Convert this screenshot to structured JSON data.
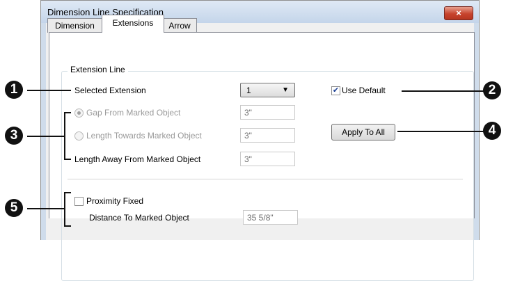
{
  "window": {
    "title": "Dimension Line Specification",
    "close_icon": "×"
  },
  "tabs": [
    {
      "label": "Dimension"
    },
    {
      "label": "Extensions"
    },
    {
      "label": "Arrow"
    }
  ],
  "extension_line": {
    "group_title": "Extension Line",
    "selected_extension_label": "Selected Extension",
    "selected_extension_value": "1",
    "use_default_label": "Use Default",
    "use_default_checked": true,
    "gap_label": "Gap From Marked Object",
    "gap_value": "3\"",
    "length_towards_label": "Length Towards Marked Object",
    "length_towards_value": "3\"",
    "length_away_label": "Length Away From Marked Object",
    "length_away_value": "3\"",
    "apply_to_all_label": "Apply To All",
    "proximity_fixed_label": "Proximity Fixed",
    "proximity_fixed_checked": false,
    "distance_label": "Distance To Marked Object",
    "distance_value": "35 5/8\""
  },
  "callouts": [
    "1",
    "2",
    "3",
    "4",
    "5"
  ]
}
